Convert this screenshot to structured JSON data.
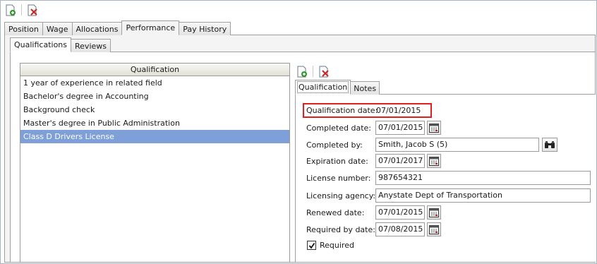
{
  "toolbar": {
    "add_icon": "add-document-icon",
    "delete_icon": "delete-document-icon"
  },
  "main_tabs": [
    "Position",
    "Wage",
    "Allocations",
    "Performance",
    "Pay History"
  ],
  "sub_tabs": [
    "Qualifications",
    "Reviews"
  ],
  "qualification_list": {
    "header": "Qualification",
    "items": [
      "1 year of experience in related field",
      "Bachelor's degree in Accounting",
      "Background check",
      "Master's degree in Public Administration",
      "Class D Drivers License"
    ],
    "selected_index": 4
  },
  "detail_tabs": [
    "Qualification",
    "Notes"
  ],
  "detail": {
    "qualification_date_label": "Qualification date:",
    "qualification_date_value": "07/01/2015",
    "completed_date_label": "Completed date:",
    "completed_date_value": "07/01/2015",
    "completed_by_label": "Completed by:",
    "completed_by_value": "Smith, Jacob S (5)",
    "expiration_date_label": "Expiration date:",
    "expiration_date_value": "07/01/2017",
    "license_number_label": "License number:",
    "license_number_value": "987654321",
    "licensing_agency_label": "Licensing agency:",
    "licensing_agency_value": "Anystate Dept of Transportation",
    "renewed_date_label": "Renewed date:",
    "renewed_date_value": "07/01/2015",
    "required_by_date_label": "Required by date:",
    "required_by_date_value": "07/08/2015",
    "required_label": "Required",
    "required_checked": true
  },
  "colors": {
    "selection": "#7f9fd8",
    "highlight_border": "#e02020"
  }
}
